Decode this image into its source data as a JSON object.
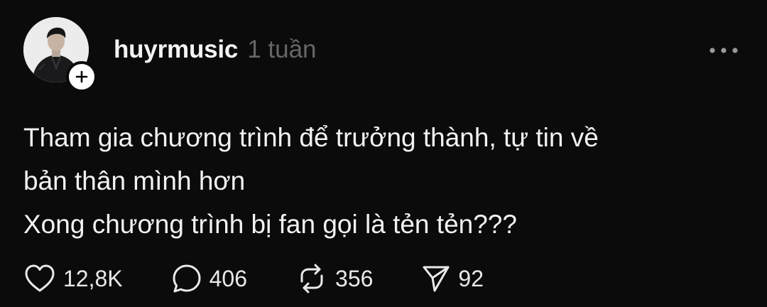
{
  "post": {
    "author": {
      "username": "huyrmusic",
      "avatar_icon": "avatar-person-icon"
    },
    "timestamp": "1 tuần",
    "body_lines": [
      "Tham gia chương trình để trưởng thành, tự tin về",
      "bản thân mình hơn",
      "Xong chương trình bị fan gọi là tẻn tẻn???"
    ],
    "actions": {
      "likes": "12,8K",
      "replies": "406",
      "reposts": "356",
      "shares": "92"
    }
  },
  "colors": {
    "background": "#0b0b0c",
    "text_primary": "#f2f2f2",
    "text_secondary": "#666666",
    "icon": "#e9e9e9"
  },
  "icons": {
    "follow": "plus-icon",
    "more": "more-horizontal-icon",
    "like": "heart-icon",
    "reply": "comment-icon",
    "repost": "repost-icon",
    "share": "send-icon"
  }
}
